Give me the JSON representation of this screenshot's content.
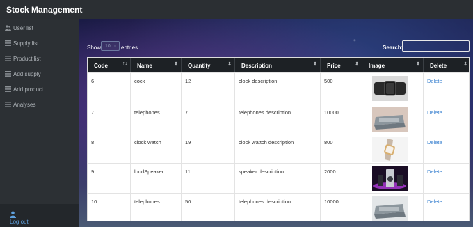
{
  "app": {
    "title": "Stock Management"
  },
  "sidebar": {
    "items": [
      {
        "label": "User list",
        "icon": "users-icon"
      },
      {
        "label": "Supply list",
        "icon": "list-icon"
      },
      {
        "label": "Product list",
        "icon": "list-icon"
      },
      {
        "label": "Add supply",
        "icon": "list-icon"
      },
      {
        "label": "Add product",
        "icon": "list-icon"
      },
      {
        "label": "Analyses",
        "icon": "list-icon"
      }
    ],
    "logout_label": "Log out"
  },
  "controls": {
    "show_label": "Show",
    "entries_value": "10",
    "entries_label": "entries",
    "search_label": "Search:",
    "search_value": ""
  },
  "table": {
    "columns": [
      "Code",
      "Name",
      "Quantity",
      "Description",
      "Price",
      "Image",
      "Delete"
    ],
    "rows": [
      {
        "code": "6",
        "name": "cock",
        "quantity": "12",
        "description": "clock description",
        "price": "500",
        "image": "smartwatch",
        "delete": "Delete"
      },
      {
        "code": "7",
        "name": "telephones",
        "quantity": "7",
        "description": "telephones description",
        "price": "10000",
        "image": "desk-phone",
        "delete": "Delete"
      },
      {
        "code": "8",
        "name": "clock watch",
        "quantity": "19",
        "description": "clock wattch description",
        "price": "800",
        "image": "gold-watch",
        "delete": "Delete"
      },
      {
        "code": "9",
        "name": "loudSpeaker",
        "quantity": "11",
        "description": "speaker description",
        "price": "2000",
        "image": "speaker",
        "delete": "Delete"
      },
      {
        "code": "10",
        "name": "telephones",
        "quantity": "50",
        "description": "telephones description",
        "price": "10000",
        "image": "desk-phone",
        "delete": "Delete"
      }
    ]
  },
  "colors": {
    "topbar": "#2b2f33",
    "sidebar": "#2c3034",
    "table_header": "#1d2125",
    "link": "#3b82d0"
  }
}
